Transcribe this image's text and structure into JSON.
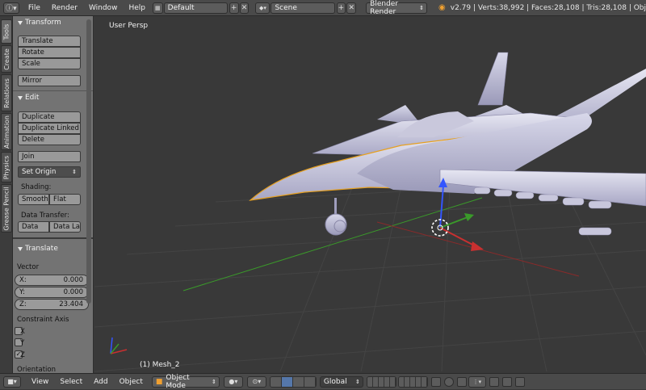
{
  "topbar": {
    "menus": [
      "File",
      "Render",
      "Window",
      "Help"
    ],
    "layout_value": "Default",
    "scene_value": "Scene",
    "renderer_value": "Blender Render",
    "stats": "v2.79 | Verts:38,992 | Faces:28,108 | Tris:28,108 | Obj"
  },
  "tabs": [
    "Tools",
    "Create",
    "Relations",
    "Animation",
    "Physics",
    "Grease Pencil"
  ],
  "transform": {
    "title": "Transform",
    "translate": "Translate",
    "rotate": "Rotate",
    "scale": "Scale",
    "mirror": "Mirror"
  },
  "edit": {
    "title": "Edit",
    "duplicate": "Duplicate",
    "duplicate_linked": "Duplicate Linked",
    "delete": "Delete",
    "join": "Join",
    "set_origin": "Set Origin",
    "shading_label": "Shading:",
    "smooth": "Smooth",
    "flat": "Flat",
    "data_transfer_label": "Data Transfer:",
    "data": "Data",
    "data_layout": "Data La"
  },
  "operator": {
    "title": "Translate",
    "vector_label": "Vector",
    "x_label": "X:",
    "x_value": "0.000",
    "y_label": "Y:",
    "y_value": "0.000",
    "z_label": "Z:",
    "z_value": "23.404",
    "constraint_label": "Constraint Axis",
    "cx": "X",
    "cy": "Y",
    "cz": "Z",
    "cz_checked": true,
    "orientation_label": "Orientation"
  },
  "viewport": {
    "view_name": "User Persp",
    "object_label": "(1) Mesh_2"
  },
  "bottombar": {
    "menus": [
      "View",
      "Select",
      "Add",
      "Object"
    ],
    "mode_value": "Object Mode",
    "orientation_value": "Global"
  },
  "colors": {
    "axis_x": "#c83030",
    "axis_y": "#3a9a2a",
    "axis_z": "#3355ff",
    "selection_outline": "#e6a020"
  }
}
